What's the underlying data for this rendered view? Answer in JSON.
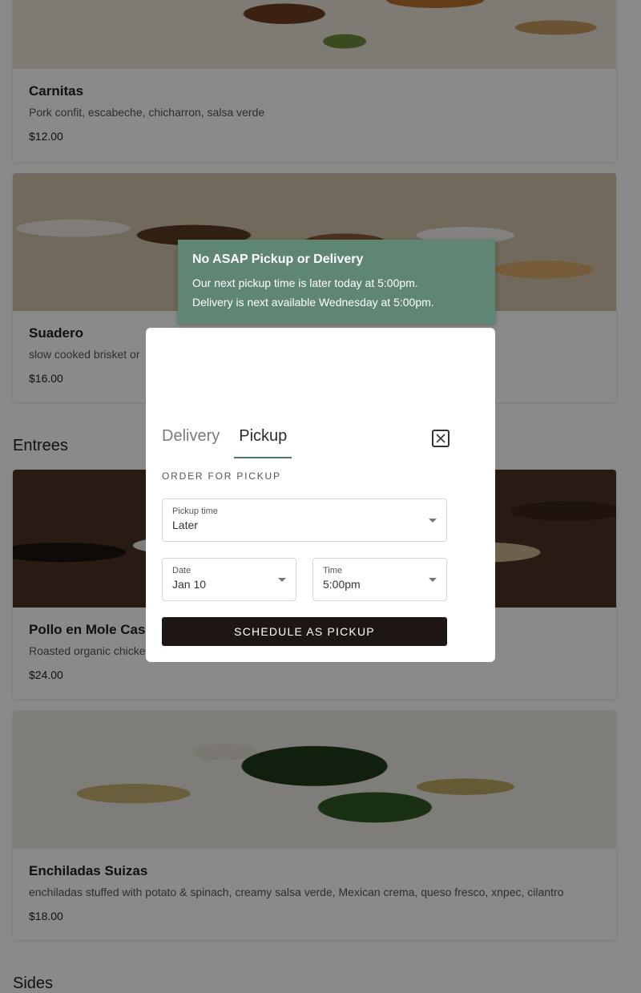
{
  "menu": {
    "top_items": [
      {
        "name": "Carnitas",
        "description": "Pork confit, escabeche, chicharron, salsa verde",
        "price": "$12.00"
      },
      {
        "name": "Suadero",
        "description": "slow cooked brisket or",
        "price": "$16.00"
      }
    ],
    "sections": [
      {
        "title": "Entrees"
      },
      {
        "title": "Sides"
      }
    ],
    "entrees": [
      {
        "name": "Pollo en Mole Casero",
        "description": "Roasted organic chicken",
        "price": "$24.00"
      },
      {
        "name": "Enchiladas Suizas",
        "description": "enchiladas stuffed with potato & spinach, creamy salsa verde, Mexican crema, queso fresco, xnpec, cilantro",
        "price": "$18.00"
      }
    ]
  },
  "toast": {
    "title": "No ASAP Pickup or Delivery",
    "line1": "Our next pickup time is later today at 5:00pm.",
    "line2": "Delivery is next available Wednesday at 5:00pm."
  },
  "modal": {
    "tabs": [
      {
        "label": "Delivery",
        "active": false
      },
      {
        "label": "Pickup",
        "active": true
      }
    ],
    "close_icon": "close-x-icon",
    "order_label": "ORDER FOR PICKUP",
    "pickup_time": {
      "label": "Pickup time",
      "value": "Later"
    },
    "date": {
      "label": "Date",
      "value": "Jan 10"
    },
    "time": {
      "label": "Time",
      "value": "5:00pm"
    },
    "cta_label": "SCHEDULE AS PICKUP"
  },
  "colors": {
    "accent_green": "#5e8673",
    "tab_underline": "#4d7a66",
    "cta_bg": "#1e1612"
  }
}
